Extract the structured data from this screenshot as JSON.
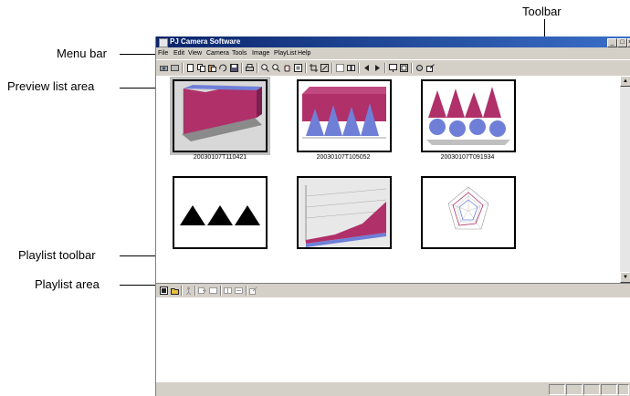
{
  "callouts": {
    "toolbar": "Toolbar",
    "menu_bar": "Menu bar",
    "preview_list_area": "Preview list area",
    "playlist_toolbar": "Playlist toolbar",
    "playlist_area": "Playlist area"
  },
  "window": {
    "title": "PJ Camera Software",
    "controls": [
      "_",
      "□",
      "×"
    ]
  },
  "menu": {
    "items": [
      "File",
      "Edit",
      "View",
      "Camera",
      "Tools",
      "Image",
      "PlayList",
      "Help"
    ]
  },
  "toolbar": {
    "icons": [
      "camera-icon",
      "film-icon",
      "new-icon",
      "copy-icon",
      "paste-icon",
      "rotate-icon",
      "save-icon",
      "print-icon",
      "zoom-in-icon",
      "zoom-out-icon",
      "hand-icon",
      "fit-icon",
      "crop-icon",
      "resize-icon",
      "select-icon",
      "compare-icon",
      "prev-icon",
      "next-icon",
      "slideshow-icon",
      "fullscreen-icon",
      "settings-icon",
      "export-icon"
    ]
  },
  "preview": {
    "thumbnails": [
      {
        "caption": "20030107T110421",
        "image": "3d-area-chart-icon",
        "selected": true
      },
      {
        "caption": "20030107T105052",
        "image": "cone-chart-icon",
        "selected": false
      },
      {
        "caption": "20030107T091934",
        "image": "3d-cone-chart-icon",
        "selected": false
      },
      {
        "caption": "",
        "image": "triangles-icon",
        "selected": false
      },
      {
        "caption": "",
        "image": "area-chart-icon",
        "selected": false
      },
      {
        "caption": "",
        "image": "radar-chart-icon",
        "selected": false
      }
    ]
  },
  "playlist_toolbar": {
    "icons": [
      "open-icon",
      "folder-icon",
      "run-icon",
      "add-icon",
      "remove-icon",
      "up-icon",
      "down-icon",
      "send-icon"
    ]
  },
  "colors": {
    "title_start": "#0a2469",
    "title_end": "#3a6fc8",
    "chrome": "#d4d0c8",
    "chart_magenta": "#b0306a",
    "chart_blue": "#6f7fd8"
  }
}
